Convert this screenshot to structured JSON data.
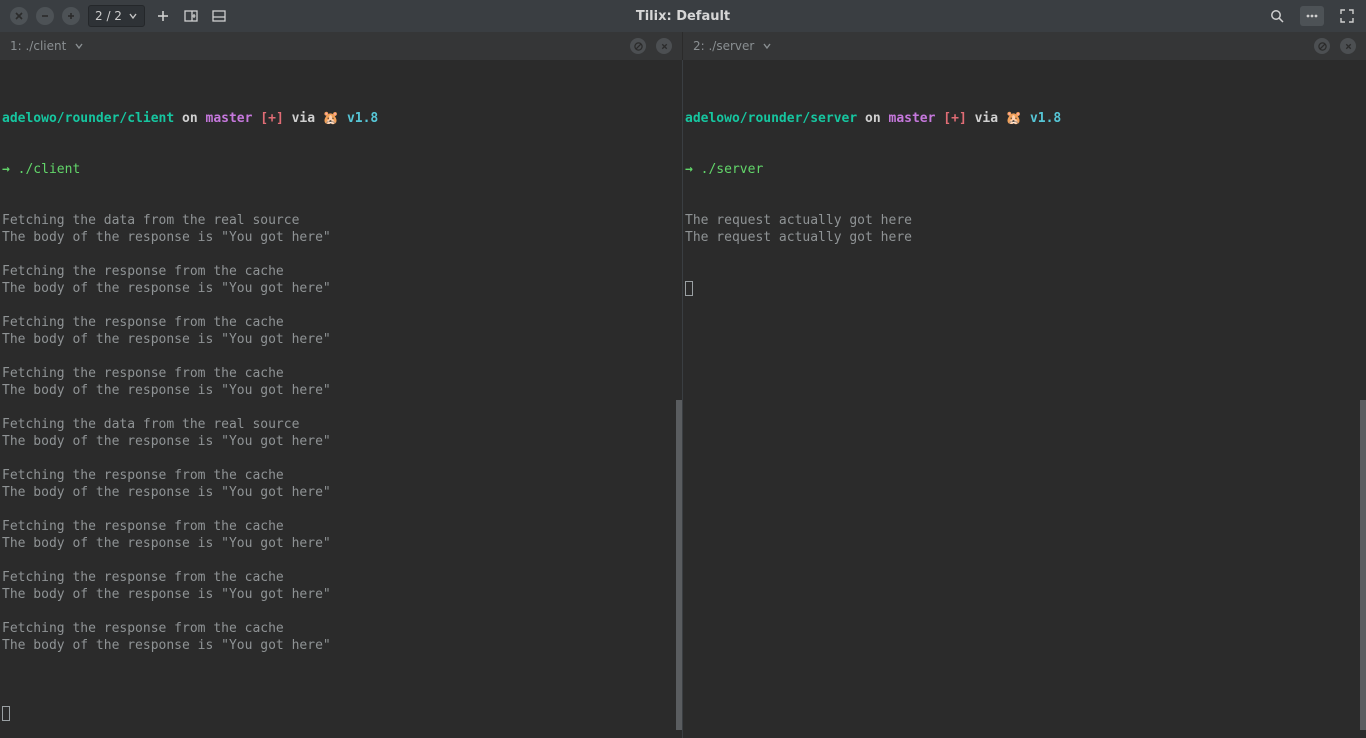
{
  "window": {
    "title": "Tilix: Default",
    "session_counter": "2 / 2"
  },
  "panes": {
    "left": {
      "title": "1: ./client",
      "prompt": {
        "path": "adelowo/rounder/client",
        "on": "on",
        "branch": "master",
        "flag": "[+]",
        "via": "via",
        "go_icon": "🐹",
        "go_ver": "v1.8",
        "arrow": "→",
        "command": "./client"
      },
      "output": [
        "Fetching the data from the real source",
        "The body of the response is \"You got here\"",
        "",
        "Fetching the response from the cache",
        "The body of the response is \"You got here\"",
        "",
        "Fetching the response from the cache",
        "The body of the response is \"You got here\"",
        "",
        "Fetching the response from the cache",
        "The body of the response is \"You got here\"",
        "",
        "Fetching the data from the real source",
        "The body of the response is \"You got here\"",
        "",
        "Fetching the response from the cache",
        "The body of the response is \"You got here\"",
        "",
        "Fetching the response from the cache",
        "The body of the response is \"You got here\"",
        "",
        "Fetching the response from the cache",
        "The body of the response is \"You got here\"",
        "",
        "Fetching the response from the cache",
        "The body of the response is \"You got here\"",
        ""
      ]
    },
    "right": {
      "title": "2: ./server",
      "prompt": {
        "path": "adelowo/rounder/server",
        "on": "on",
        "branch": "master",
        "flag": "[+]",
        "via": "via",
        "go_icon": "🐹",
        "go_ver": "v1.8",
        "arrow": "→",
        "command": "./server"
      },
      "output": [
        "The request actually got here",
        "The request actually got here"
      ]
    }
  }
}
